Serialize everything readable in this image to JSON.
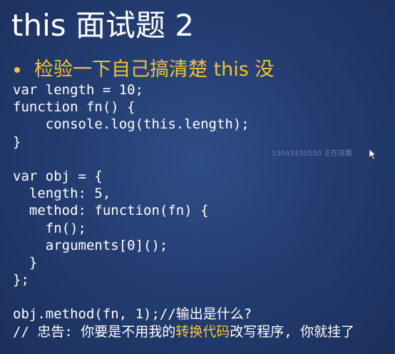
{
  "slide": {
    "title": "this 面试题 2",
    "bullet": "检验一下自己搞清楚 this 没",
    "code_lines": [
      "var length = 10;",
      "function fn() {",
      "    console.log(this.length);",
      "}",
      "",
      "var obj = {",
      "  length: 5,",
      "  method: function(fn) {",
      "    fn();",
      "    arguments[0]();",
      "  }",
      "};",
      "",
      "obj.method(fn, 1);//输出是什么?"
    ],
    "warning": {
      "prefix": "// 忠告: 你要是不用我的",
      "highlight": "转换代码",
      "suffix": "改写程序, 你就挂了"
    },
    "watermark": "13043435550 正在观看"
  },
  "colors": {
    "background": "#243e72",
    "title": "#ffffff",
    "bullet": "#f3c332",
    "code": "#ffffff",
    "highlight": "#f2c744"
  },
  "icons": {
    "cursor": "mouse-pointer-icon"
  }
}
